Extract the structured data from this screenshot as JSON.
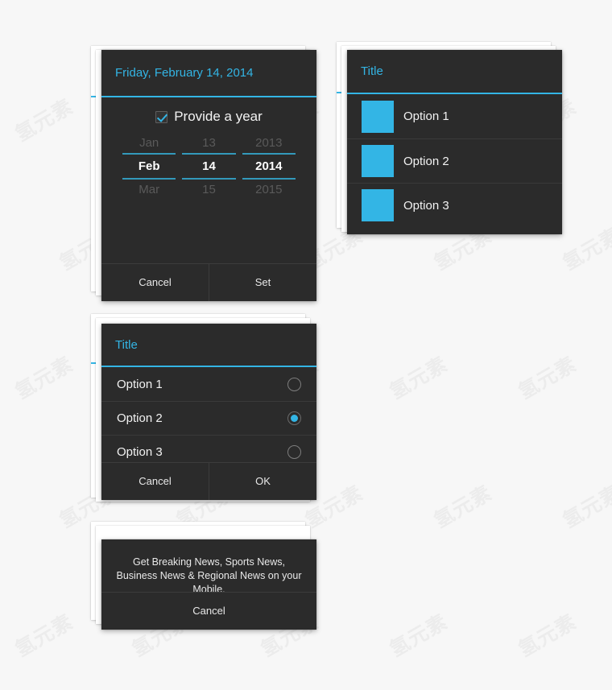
{
  "canvas": {
    "background_color": "#f7f7f7",
    "accent_color": "#33b5e5",
    "dialog_color": "#2b2b2b",
    "watermark_text": "氢元素"
  },
  "date_picker_dialog": {
    "header_date": "Friday, February 14, 2014",
    "checkbox": {
      "label": "Provide a year",
      "checked": true
    },
    "spinners": [
      {
        "name": "month",
        "previous": "Jan",
        "current": "Feb",
        "next": "Mar"
      },
      {
        "name": "day",
        "previous": "13",
        "current": "14",
        "next": "15"
      },
      {
        "name": "year",
        "previous": "2013",
        "current": "2014",
        "next": "2015"
      }
    ],
    "buttons": {
      "cancel": "Cancel",
      "confirm": "Set"
    }
  },
  "image_list_dialog": {
    "title": "Title",
    "options": [
      {
        "label": "Option 1",
        "swatch_color": "#33b5e5"
      },
      {
        "label": "Option 2",
        "swatch_color": "#33b5e5"
      },
      {
        "label": "Option 3",
        "swatch_color": "#33b5e5"
      }
    ]
  },
  "radio_dialog": {
    "title": "Title",
    "options": [
      {
        "label": "Option 1",
        "selected": false
      },
      {
        "label": "Option 2",
        "selected": true
      },
      {
        "label": "Option 3",
        "selected": false
      }
    ],
    "buttons": {
      "cancel": "Cancel",
      "confirm": "OK"
    }
  },
  "message_dialog": {
    "message": "Get Breaking News, Sports News, Business News & Regional News on your Mobile.",
    "buttons": {
      "cancel": "Cancel"
    }
  }
}
